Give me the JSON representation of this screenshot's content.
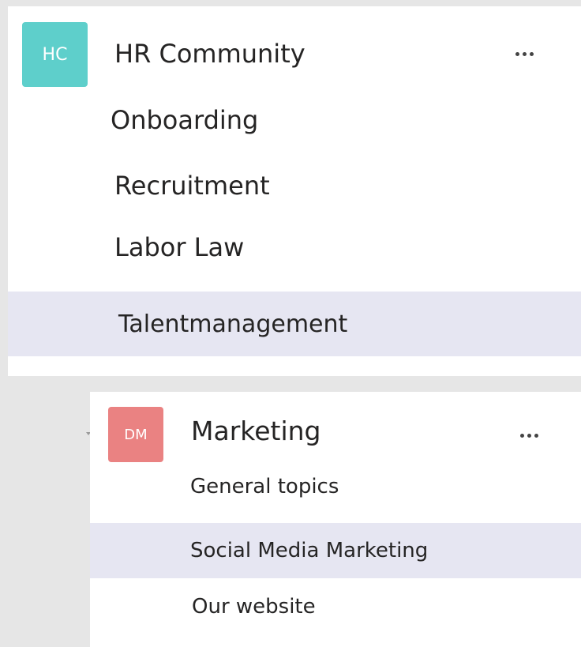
{
  "teams": [
    {
      "name": "HR Community",
      "avatar_initials": "HC",
      "avatar_color": "#5ecfcb",
      "more_icon": "ellipsis-icon",
      "channels": [
        {
          "label": "Onboarding",
          "selected": false
        },
        {
          "label": "Recruitment",
          "selected": false
        },
        {
          "label": "Labor Law",
          "selected": false
        },
        {
          "label": "Talentmanagement",
          "selected": true
        }
      ]
    },
    {
      "name": "Marketing",
      "avatar_initials": "DM",
      "avatar_color": "#ea8282",
      "more_icon": "ellipsis-icon",
      "expand_icon": "caret-down-icon",
      "channels": [
        {
          "label": "General topics",
          "selected": false
        },
        {
          "label": "Social Media Marketing",
          "selected": true
        },
        {
          "label": "Our website",
          "selected": false
        }
      ]
    }
  ],
  "colors": {
    "background": "#e6e6e6",
    "panel": "#ffffff",
    "selected_row": "#e6e6f2",
    "text": "#252424"
  }
}
